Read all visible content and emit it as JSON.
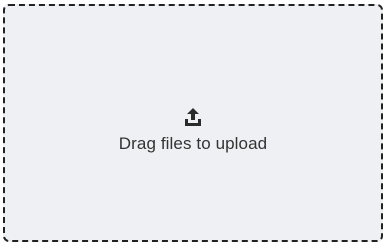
{
  "dropzone": {
    "icon": "upload-icon",
    "label": "Drag files to upload"
  },
  "colors": {
    "background": "#eef0f4",
    "border": "#222222",
    "text": "#333333",
    "icon": "#2b2b2b"
  }
}
